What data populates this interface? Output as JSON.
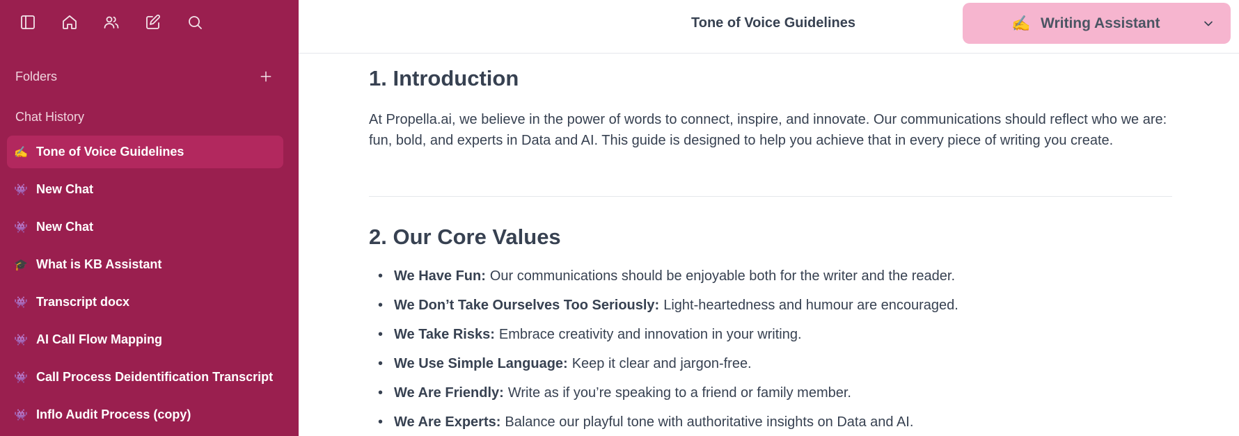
{
  "sidebar": {
    "top_icons": [
      "sidebar-toggle-icon",
      "home-icon",
      "users-icon",
      "edit-icon",
      "search-icon"
    ],
    "folders_label": "Folders",
    "history_label": "Chat History",
    "chats": [
      {
        "emoji": "✍️",
        "label": "Tone of Voice Guidelines",
        "active": true
      },
      {
        "emoji": "👾",
        "label": "New Chat"
      },
      {
        "emoji": "👾",
        "label": "New Chat"
      },
      {
        "emoji": "🎓",
        "label": "What is KB Assistant"
      },
      {
        "emoji": "👾",
        "label": "Transcript docx"
      },
      {
        "emoji": "👾",
        "label": "AI Call Flow Mapping"
      },
      {
        "emoji": "👾",
        "label": "Call Process Deidentification Transcript"
      },
      {
        "emoji": "👾",
        "label": "Inflo Audit Process (copy)"
      }
    ]
  },
  "header": {
    "title": "Tone of Voice Guidelines",
    "assistant": {
      "emoji": "✍️",
      "label": "Writing Assistant"
    }
  },
  "content": {
    "intro_heading": "1. Introduction",
    "intro_text": "At Propella.ai, we believe in the power of words to connect, inspire, and innovate. Our communications should reflect who we are: fun, bold, and experts in Data and AI. This guide is designed to help you achieve that in every piece of writing you create.",
    "values_heading": "2. Our Core Values",
    "values": [
      {
        "title": "We Have Fun:",
        "text": "Our communications should be enjoyable both for the writer and the reader."
      },
      {
        "title": "We Don’t Take Ourselves Too Seriously:",
        "text": "Light-heartedness and humour are encouraged."
      },
      {
        "title": "We Take Risks:",
        "text": "Embrace creativity and innovation in your writing."
      },
      {
        "title": "We Use Simple Language:",
        "text": "Keep it clear and jargon-free."
      },
      {
        "title": "We Are Friendly:",
        "text": "Write as if you’re speaking to a friend or family member."
      },
      {
        "title": "We Are Experts:",
        "text": "Balance our playful tone with authoritative insights on Data and AI."
      }
    ]
  },
  "colors": {
    "sidebar_bg": "#9a1f4f",
    "active_item": "#b2285e",
    "assistant_btn": "#f6b5cf",
    "text": "#374151"
  }
}
